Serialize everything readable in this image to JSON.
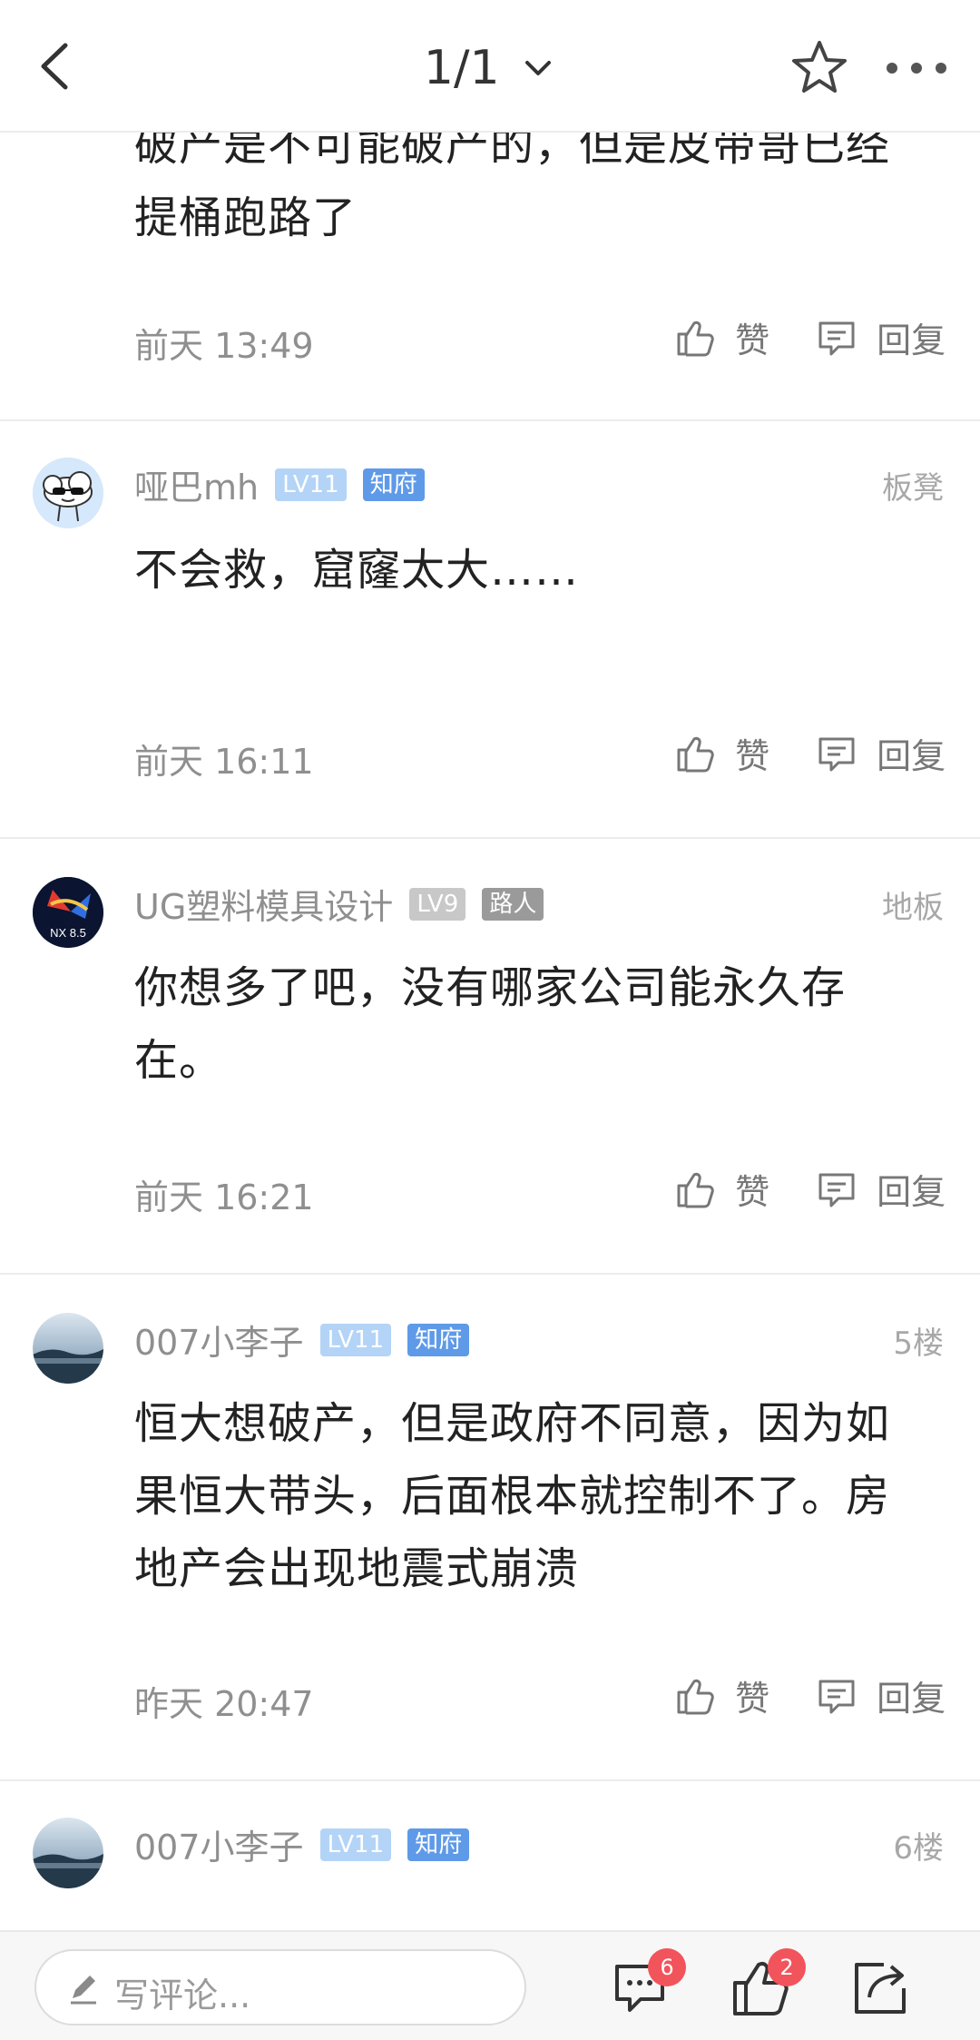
{
  "header": {
    "page_indicator": "1/1",
    "icons": [
      "back-arrow-icon",
      "chevron-down-icon",
      "star-icon",
      "more-icon"
    ]
  },
  "posts": [
    {
      "text": "破产是不可能破产的，但是皮带哥已经提桶跑路了",
      "time": "前天 13:49",
      "like_label": "赞",
      "reply_label": "回复"
    },
    {
      "username": "哑巴mh",
      "level": "LV11",
      "title": "知府",
      "floor": "板凳",
      "text": "不会救，窟窿太大……",
      "time": "前天 16:11",
      "like_label": "赞",
      "reply_label": "回复"
    },
    {
      "username": "UG塑料模具设计",
      "level": "LV9",
      "title": "路人",
      "floor": "地板",
      "avatar_text": "NX 8.5",
      "text": "你想多了吧，没有哪家公司能永久存在。",
      "time": "前天 16:21",
      "like_label": "赞",
      "reply_label": "回复"
    },
    {
      "username": "007小李子",
      "level": "LV11",
      "title": "知府",
      "floor": "5楼",
      "text": "恒大想破产，但是政府不同意，因为如果恒大带头，后面根本就控制不了。房地产会出现地震式崩溃",
      "time": "昨天 20:47",
      "like_label": "赞",
      "reply_label": "回复"
    },
    {
      "username": "007小李子",
      "level": "LV11",
      "title": "知府",
      "floor": "6楼"
    }
  ],
  "bottom": {
    "comment_placeholder": "写评论...",
    "comment_count": "6",
    "like_count": "2",
    "icons": [
      "pencil-icon",
      "comment-icon",
      "like-icon",
      "share-icon"
    ]
  },
  "colors": {
    "level_badge": "#b3d4f7",
    "title_badge": "#5e9ae8",
    "red_dot": "#f2545b"
  }
}
